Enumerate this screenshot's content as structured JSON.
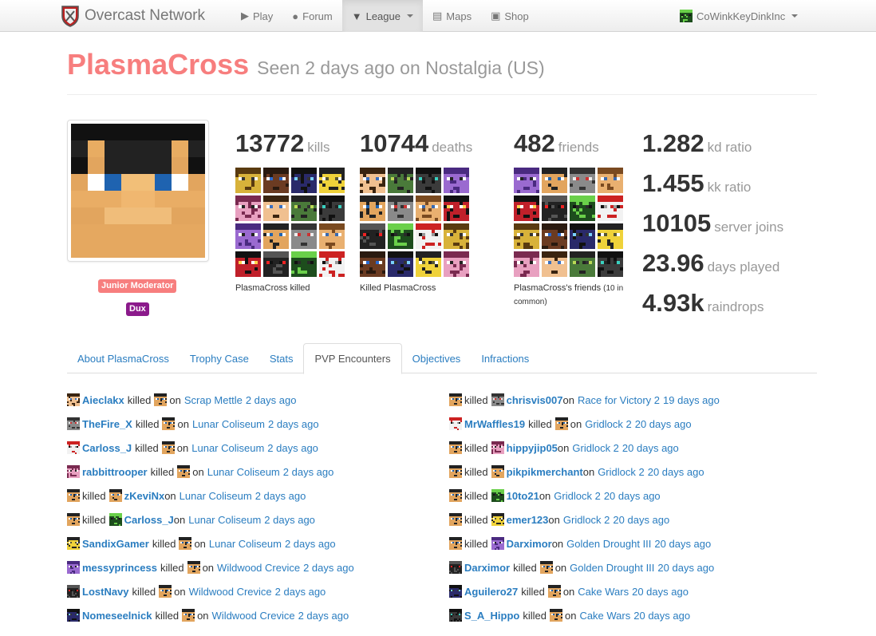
{
  "navbar": {
    "brand": "Overcast Network",
    "items": [
      {
        "label": "Play",
        "icon": "play-icon"
      },
      {
        "label": "Forum",
        "icon": "comments-icon"
      },
      {
        "label": "League",
        "icon": "trophy-icon"
      },
      {
        "label": "Maps",
        "icon": "maps-icon"
      },
      {
        "label": "Shop",
        "icon": "cart-icon"
      }
    ],
    "user": "CoWinkKeyDinkInc"
  },
  "profile": {
    "username": "PlasmaCross",
    "seen": "Seen 2 days ago on Nostalgia (US)",
    "badges": [
      "Junior Moderator",
      "Dux"
    ]
  },
  "stats": {
    "kills": {
      "value": "13772",
      "label": "kills",
      "caption": "PlasmaCross killed"
    },
    "deaths": {
      "value": "10744",
      "label": "deaths",
      "caption": "Killed PlasmaCross"
    },
    "friends": {
      "value": "482",
      "label": "friends",
      "caption": "PlasmaCross's friends",
      "caption_small": "(10 in common)"
    },
    "side": [
      {
        "value": "1.282",
        "label": "kd ratio"
      },
      {
        "value": "1.455",
        "label": "kk ratio"
      },
      {
        "value": "10105",
        "label": "server joins"
      },
      {
        "value": "23.96",
        "label": "days played"
      },
      {
        "value": "4.93k",
        "label": "raindrops"
      }
    ]
  },
  "tabs": [
    "About PlasmaCross",
    "Trophy Case",
    "Stats",
    "PVP Encounters",
    "Objectives",
    "Infractions"
  ],
  "encounters_left": [
    {
      "player": "Aieclakx",
      "map": "Scrap Mettle",
      "time": "2 days ago",
      "self_killed": false
    },
    {
      "player": "TheFire_X",
      "map": "Lunar Coliseum",
      "time": "2 days ago",
      "self_killed": false
    },
    {
      "player": "Carloss_J",
      "map": "Lunar Coliseum",
      "time": "2 days ago",
      "self_killed": false
    },
    {
      "player": "rabbittrooper",
      "map": "Lunar Coliseum",
      "time": "2 days ago",
      "self_killed": false
    },
    {
      "player": "zKeviNx",
      "map": "Lunar Coliseum",
      "time": "2 days ago",
      "self_killed": true
    },
    {
      "player": "Carloss_J",
      "map": "Lunar Coliseum",
      "time": "2 days ago",
      "self_killed": true
    },
    {
      "player": "SandixGamer",
      "map": "Lunar Coliseum",
      "time": "2 days ago",
      "self_killed": false
    },
    {
      "player": "messyprincess",
      "map": "Wildwood Crevice",
      "time": "2 days ago",
      "self_killed": false
    },
    {
      "player": "LostNavy",
      "map": "Wildwood Crevice",
      "time": "2 days ago",
      "self_killed": false
    },
    {
      "player": "Nomeseelnick",
      "map": "Wildwood Crevice",
      "time": "2 days ago",
      "self_killed": false
    }
  ],
  "encounters_right": [
    {
      "player": "chrisvis007",
      "map": "Race for Victory 2",
      "time": "19 days ago",
      "self_killed": true
    },
    {
      "player": "MrWaffles19",
      "map": "Gridlock 2",
      "time": "20 days ago",
      "self_killed": false
    },
    {
      "player": "hippyjip05",
      "map": "Gridlock 2",
      "time": "20 days ago",
      "self_killed": true
    },
    {
      "player": "pikpikmerchant",
      "map": "Gridlock 2",
      "time": "20 days ago",
      "self_killed": true
    },
    {
      "player": "10to21",
      "map": "Gridlock 2",
      "time": "20 days ago",
      "self_killed": true
    },
    {
      "player": "emer123",
      "map": "Gridlock 2",
      "time": "20 days ago",
      "self_killed": true
    },
    {
      "player": "Darximor",
      "map": "Golden Drought III",
      "time": "20 days ago",
      "self_killed": true
    },
    {
      "player": "Darximor",
      "map": "Golden Drought III",
      "time": "20 days ago",
      "self_killed": false
    },
    {
      "player": "Aguilero27",
      "map": "Cake Wars",
      "time": "20 days ago",
      "self_killed": false
    },
    {
      "player": "S_A_Hippo",
      "map": "Cake Wars",
      "time": "20 days ago",
      "self_killed": false
    }
  ],
  "words": {
    "killed": "killed",
    "on": "on"
  },
  "colors": {
    "accent": "#f77e7e",
    "link": "#2a7dc0",
    "dux": "#8b1a8b"
  }
}
